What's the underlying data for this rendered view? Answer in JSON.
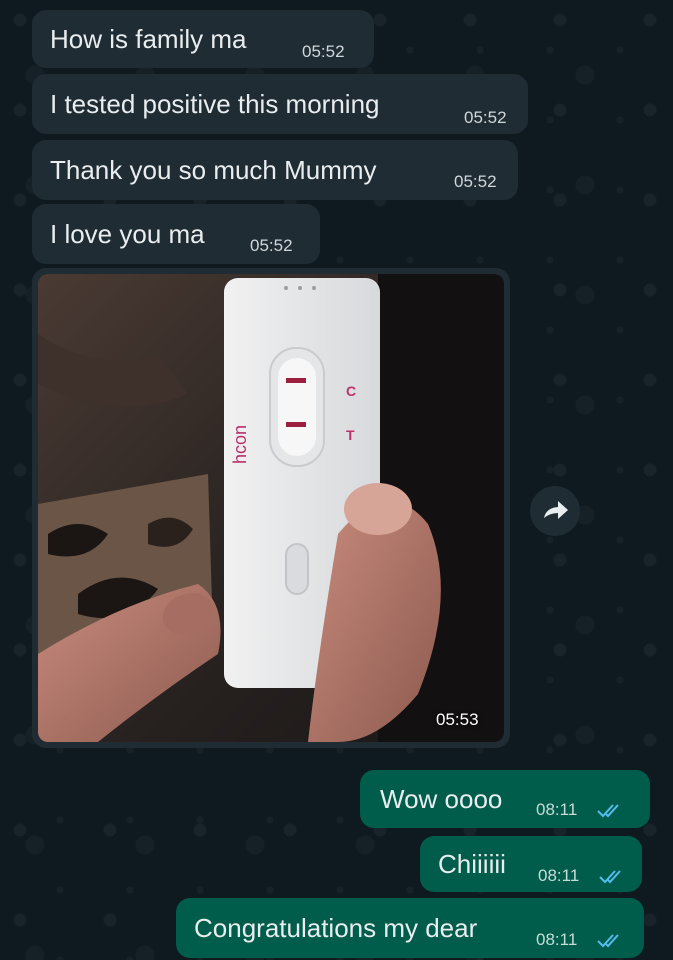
{
  "conversation": {
    "messages": [
      {
        "direction": "incoming",
        "text": "How is family ma",
        "time": "05:52"
      },
      {
        "direction": "incoming",
        "text": "I tested positive this morning",
        "time": "05:52"
      },
      {
        "direction": "incoming",
        "text": "Thank you so much Mummy",
        "time": "05:52"
      },
      {
        "direction": "incoming",
        "text": "I love you ma",
        "time": "05:52"
      },
      {
        "direction": "incoming",
        "type": "image",
        "time": "05:53",
        "image_label": "hcon"
      },
      {
        "direction": "outgoing",
        "text": "Wow oooo",
        "time": "08:11",
        "status": "read"
      },
      {
        "direction": "outgoing",
        "text": "Chiiiiii",
        "time": "08:11",
        "status": "read"
      },
      {
        "direction": "outgoing",
        "text": "Congratulations my dear",
        "time": "08:11",
        "status": "read"
      }
    ]
  },
  "icons": {
    "forward": "forward-arrow-icon",
    "read_receipt": "double-check-icon"
  },
  "colors": {
    "background": "#0e1a20",
    "incoming_bubble": "#1f2c33",
    "outgoing_bubble": "#005c4b",
    "read_ticks": "#53bdeb",
    "test_lines": "#9c1f3e"
  }
}
